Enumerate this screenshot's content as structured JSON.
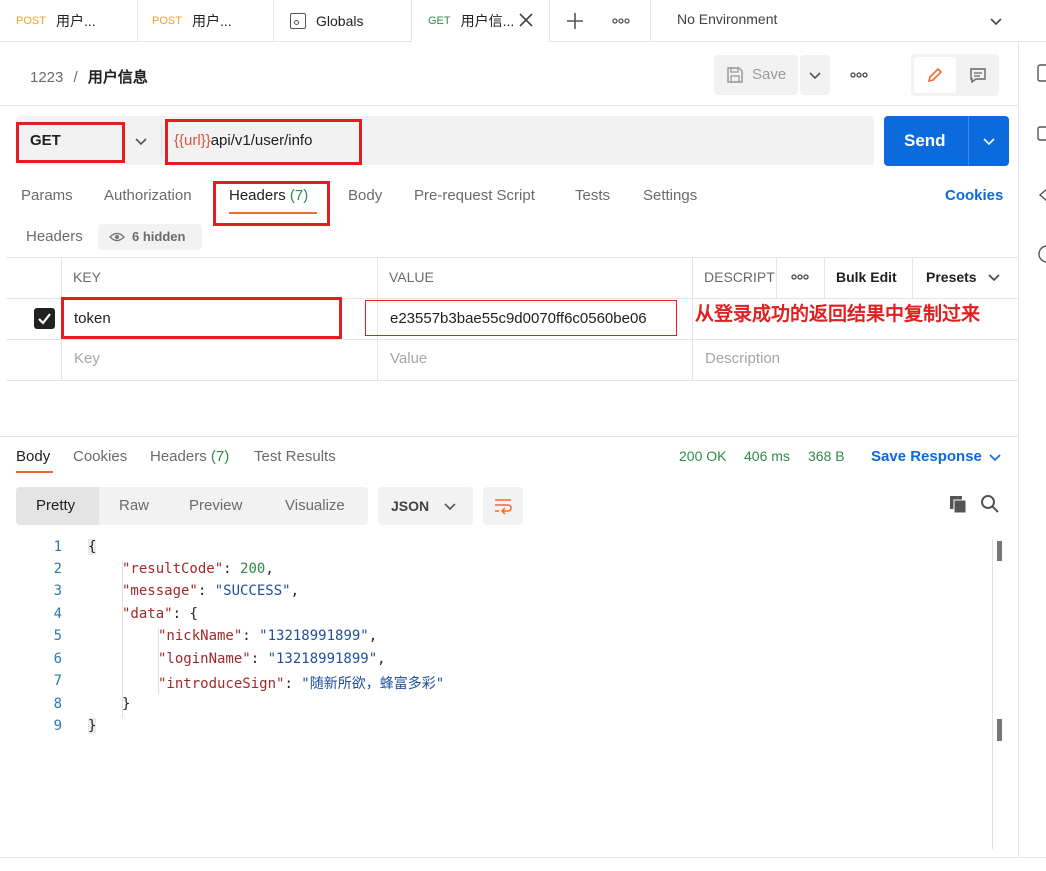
{
  "tabs": [
    {
      "method": "POST",
      "label": "用户..."
    },
    {
      "method": "POST",
      "label": "用户..."
    },
    {
      "method": "",
      "label": "Globals"
    },
    {
      "method": "GET",
      "label": "用户信..."
    }
  ],
  "environment": "No Environment",
  "breadcrumb": {
    "collection": "1223",
    "separator": "/",
    "request": "用户信息"
  },
  "toolbar": {
    "save_label": "Save"
  },
  "request": {
    "method": "GET",
    "url_var": "{{url}}",
    "url_path": "api/v1/user/info",
    "send_label": "Send"
  },
  "req_tabs": {
    "params": "Params",
    "authorization": "Authorization",
    "headers": "Headers",
    "headers_count": "(7)",
    "body": "Body",
    "prerequest": "Pre-request Script",
    "tests": "Tests",
    "settings": "Settings",
    "cookies": "Cookies"
  },
  "headers_sub": {
    "title": "Headers",
    "hidden": "6 hidden"
  },
  "headers_table": {
    "col_key": "KEY",
    "col_value": "VALUE",
    "col_desc": "DESCRIPT",
    "bulk_edit": "Bulk Edit",
    "presets": "Presets",
    "row": {
      "key": "token",
      "value": "e23557b3bae55c9d0070ff6c0560be06",
      "checked": true
    },
    "placeholder": {
      "key": "Key",
      "value": "Value",
      "description": "Description"
    }
  },
  "annotation": "从登录成功的返回结果中复制过来",
  "response": {
    "tabs": {
      "body": "Body",
      "cookies": "Cookies",
      "headers": "Headers",
      "headers_count": "(7)",
      "test_results": "Test Results"
    },
    "status": "200 OK",
    "time": "406 ms",
    "size": "368 B",
    "save_response": "Save Response",
    "views": {
      "pretty": "Pretty",
      "raw": "Raw",
      "preview": "Preview",
      "visualize": "Visualize"
    },
    "format": "JSON",
    "code_lines": [
      {
        "n": "1"
      },
      {
        "n": "2"
      },
      {
        "n": "3"
      },
      {
        "n": "4"
      },
      {
        "n": "5"
      },
      {
        "n": "6"
      },
      {
        "n": "7"
      },
      {
        "n": "8"
      },
      {
        "n": "9"
      }
    ],
    "json": {
      "open": "{",
      "k1": "\"resultCode\"",
      "v1": "200",
      "k2": "\"message\"",
      "v2": "\"SUCCESS\"",
      "k3": "\"data\"",
      "v3": "{",
      "k4": "\"nickName\"",
      "v4": "\"13218991899\"",
      "k5": "\"loginName\"",
      "v5": "\"13218991899\"",
      "k6": "\"introduceSign\"",
      "v6": "\"随新所欲，蜂富多彩\"",
      "close_inner": "}",
      "close": "}"
    }
  },
  "colors": {
    "accent": "#0b6bdc",
    "annotation": "#e02020",
    "method_post": "#f0a030",
    "method_get": "#2f8a4a"
  }
}
